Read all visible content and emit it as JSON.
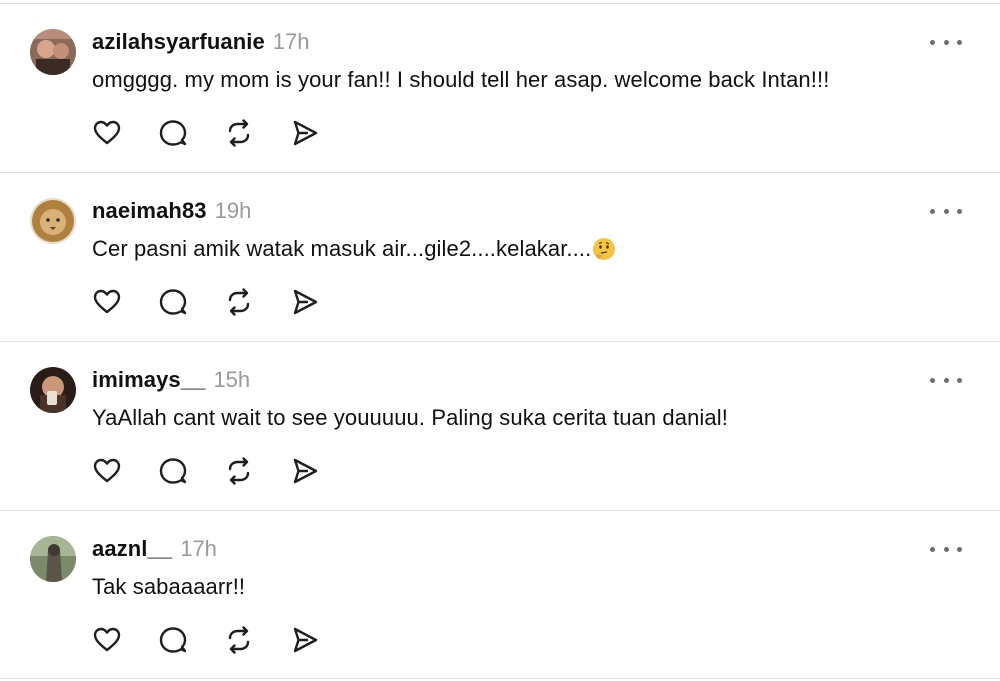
{
  "posts": [
    {
      "username": "azilahsyarfuanie",
      "time": "17h",
      "text": "omgggg. my mom is your fan!! I should tell her asap. welcome back Intan!!!",
      "emoji": ""
    },
    {
      "username": "naeimah83",
      "time": "19h",
      "text": "Cer pasni amik watak masuk air...gile2....kelakar....",
      "emoji": "🤔"
    },
    {
      "username": "imimays__",
      "time": "15h",
      "text": "YaAllah cant wait to see youuuuu. Paling suka cerita tuan danial!",
      "emoji": ""
    },
    {
      "username": "aaznl__",
      "time": "17h",
      "text": "Tak sabaaaarr!!",
      "emoji": ""
    }
  ],
  "icons": {
    "like": "heart-icon",
    "comment": "comment-bubble-icon",
    "repost": "repost-icon",
    "share": "send-icon",
    "more": "more-options-icon"
  },
  "colors": {
    "text": "#111111",
    "timestamp": "#9a9a9a",
    "divider": "#e3e3e3",
    "icon": "#1f1f1f"
  }
}
